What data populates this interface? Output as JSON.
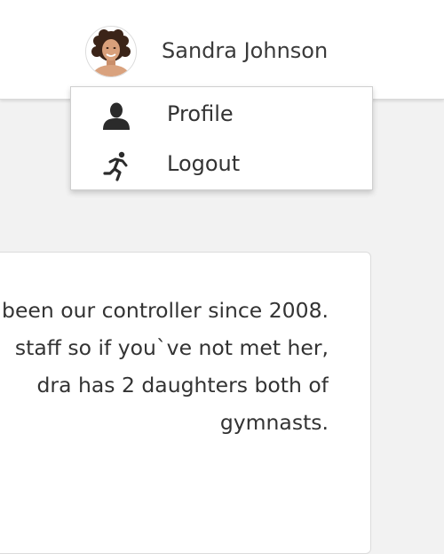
{
  "header": {
    "user_name": "Sandra Johnson",
    "avatar_icon": "user-avatar-photo"
  },
  "user_dropdown": {
    "items": [
      {
        "label": "Profile",
        "icon": "person-icon"
      },
      {
        "label": "Logout",
        "icon": "running-person-icon"
      }
    ]
  },
  "bio_card": {
    "lines": [
      "been our controller since 2008.",
      " staff so if you`ve not met her,",
      "dra has 2 daughters both of",
      "gymnasts."
    ]
  }
}
